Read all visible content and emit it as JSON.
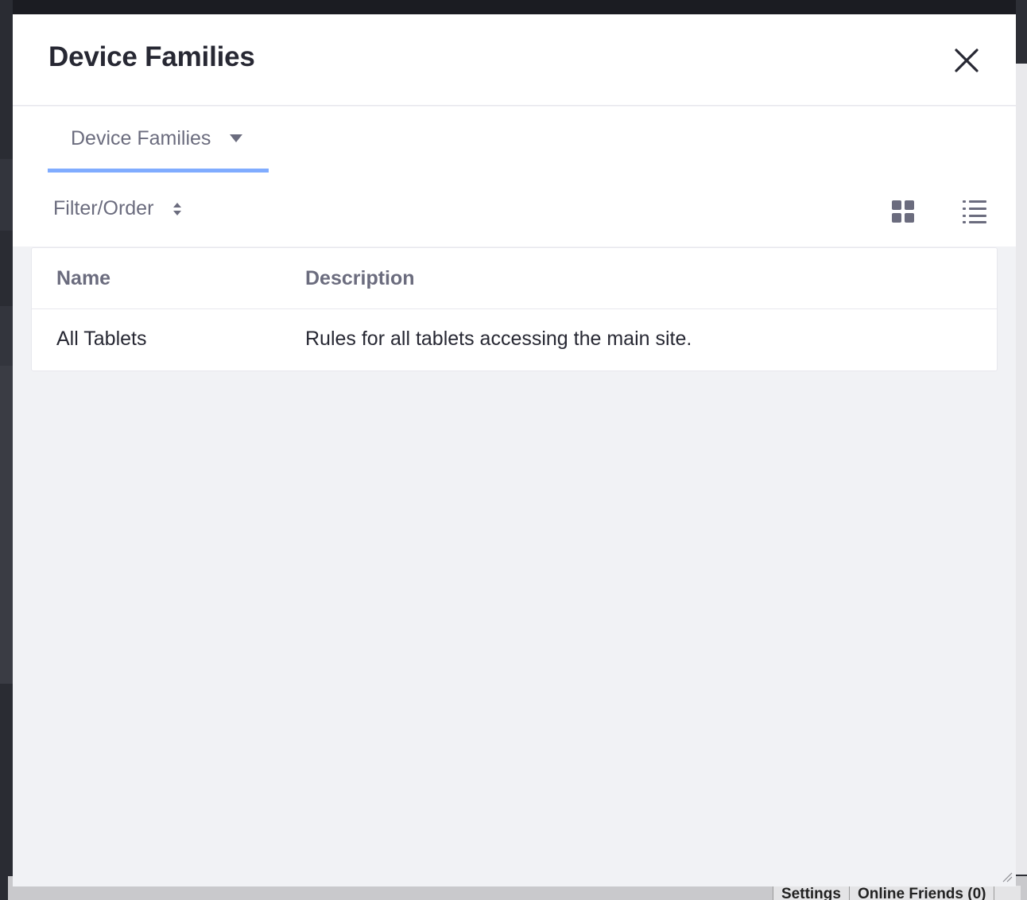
{
  "modal": {
    "title": "Device Families"
  },
  "nav": {
    "active_tab_label": "Device Families"
  },
  "toolbar": {
    "filter_label": "Filter/Order"
  },
  "table": {
    "columns": [
      "Name",
      "Description"
    ],
    "rows": [
      {
        "name": "All Tablets",
        "description": "Rules for all tablets accessing the main site."
      }
    ]
  },
  "dock": {
    "items": [
      "Settings",
      "Online Friends (0)"
    ]
  },
  "icons": {
    "close": "close-icon",
    "caret": "caret-down-icon",
    "sort": "sort-icon",
    "cards": "cards-view-icon",
    "list": "list-view-icon"
  },
  "colors": {
    "accent": "#80acff",
    "title_text": "#272833",
    "secondary_text": "#6b6c7e",
    "modal_body": "#f1f2f5"
  }
}
